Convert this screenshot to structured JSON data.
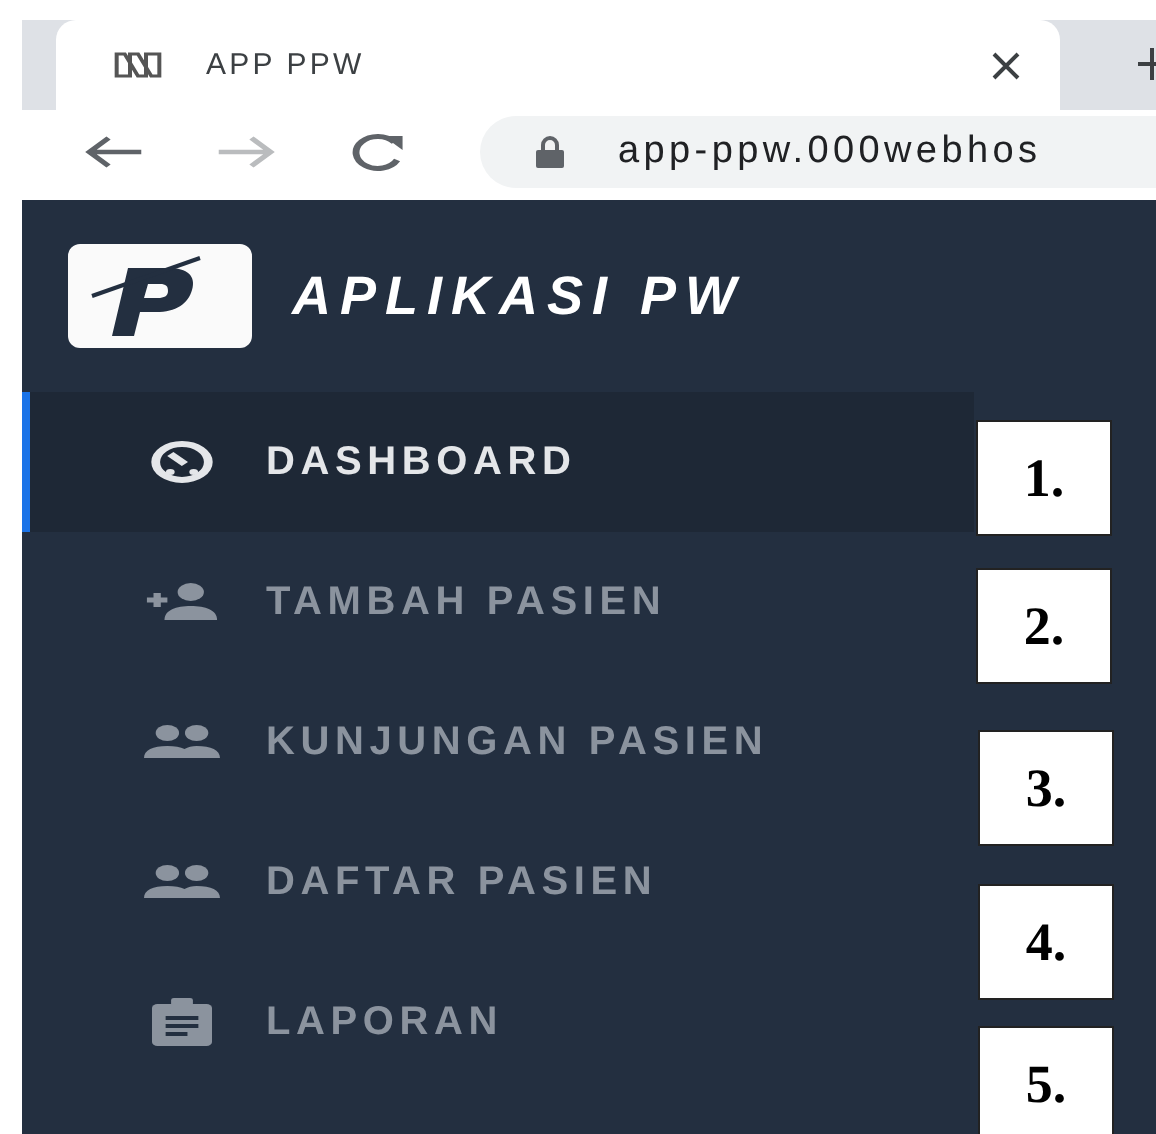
{
  "browser": {
    "tab_title": "APP PPW",
    "url": "app-ppw.000webhos"
  },
  "sidebar": {
    "brand": "APLIKASI PW",
    "items": [
      {
        "label": "DASHBOARD",
        "kind": "dashboard",
        "selected": true
      },
      {
        "label": "TAMBAH PASIEN",
        "kind": "add-user",
        "selected": false
      },
      {
        "label": "KUNJUNGAN PASIEN",
        "kind": "users",
        "selected": false
      },
      {
        "label": "DAFTAR PASIEN",
        "kind": "users",
        "selected": false
      },
      {
        "label": "LAPORAN",
        "kind": "clipboard",
        "selected": false
      }
    ]
  },
  "annotations": [
    "1.",
    "2.",
    "3.",
    "4.",
    "5."
  ]
}
